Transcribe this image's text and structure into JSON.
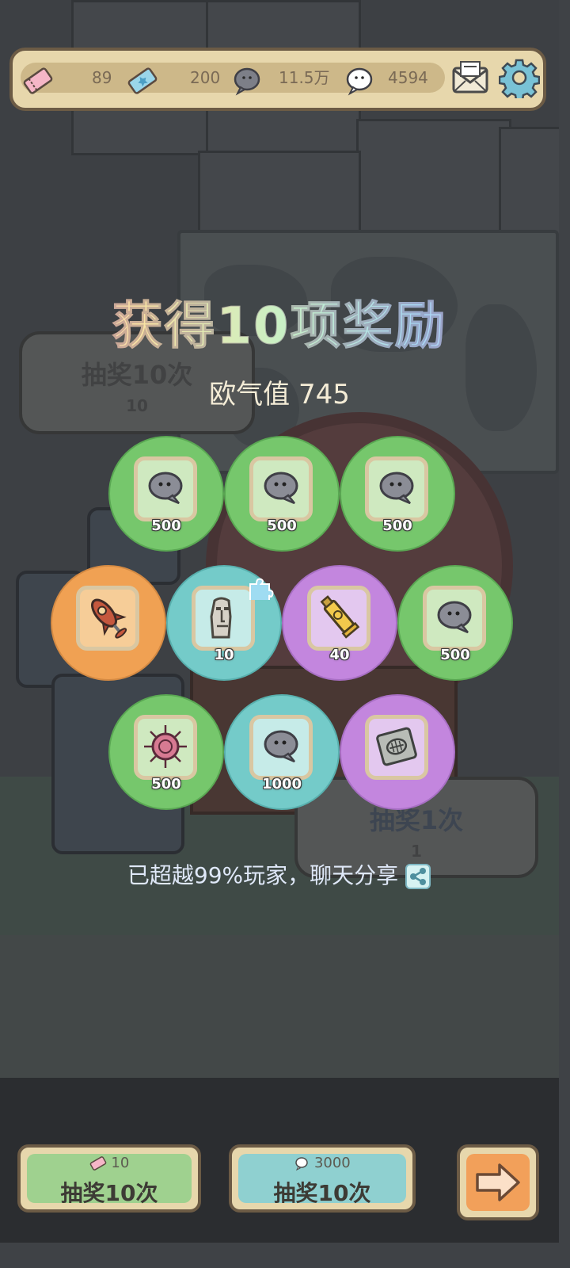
{
  "resources": {
    "ticket_pink": {
      "icon": "pink-ticket-icon",
      "value": "89"
    },
    "ticket_blue": {
      "icon": "blue-ticket-icon",
      "value": "200"
    },
    "bubble_gray": {
      "icon": "gray-bubble-icon",
      "value": "11.5万"
    },
    "bubble_white": {
      "icon": "white-bubble-icon",
      "value": "4594"
    }
  },
  "header_buttons": {
    "mail": "mail-icon",
    "settings": "gear-icon"
  },
  "background_buttons": {
    "draw10": {
      "label": "抽奖10次",
      "cost": "10"
    },
    "draw1": {
      "label": "抽奖1次",
      "cost": "1"
    }
  },
  "result": {
    "title": "获得10项奖励",
    "luck_label": "欧气值 745",
    "rewards": [
      {
        "icon": "gray-bubble-icon",
        "qty": "500",
        "rarity": "green"
      },
      {
        "icon": "gray-bubble-icon",
        "qty": "500",
        "rarity": "green"
      },
      {
        "icon": "gray-bubble-icon",
        "qty": "500",
        "rarity": "green"
      },
      {
        "icon": "rocket-lamp-icon",
        "qty": "",
        "rarity": "orange"
      },
      {
        "icon": "moai-statue-icon",
        "qty": "10",
        "rarity": "teal"
      },
      {
        "icon": "paint-tube-icon",
        "qty": "40",
        "rarity": "purple"
      },
      {
        "icon": "gray-bubble-icon",
        "qty": "500",
        "rarity": "green"
      },
      {
        "icon": "sea-urchin-icon",
        "qty": "500",
        "rarity": "green"
      },
      {
        "icon": "gray-bubble-icon",
        "qty": "1000",
        "rarity": "teal"
      },
      {
        "icon": "fossil-slab-icon",
        "qty": "",
        "rarity": "purple"
      }
    ],
    "share_text": "已超越99%玩家，聊天分享"
  },
  "bottom_buttons": {
    "draw_ticket": {
      "cost": "10",
      "label": "抽奖10次"
    },
    "draw_bubble": {
      "cost": "3000",
      "label": "抽奖10次"
    },
    "next": "arrow-right-icon"
  },
  "colors": {
    "green": "#76c76c",
    "orange": "#f0a153",
    "teal": "#74cbc9",
    "purple": "#c386de",
    "panel": "#e7d7ac",
    "border": "#6c5b45"
  }
}
